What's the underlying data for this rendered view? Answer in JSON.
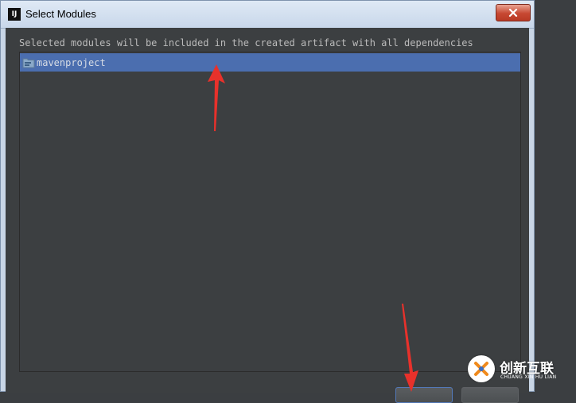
{
  "window": {
    "title": "Select Modules",
    "app_icon": "intellij-icon",
    "close_icon": "close-icon"
  },
  "dialog": {
    "description": "Selected modules will be included in the created artifact with all dependencies",
    "modules": [
      {
        "label": "mavenproject",
        "icon": "module-folder-icon",
        "selected": true
      }
    ]
  },
  "annotations": {
    "arrow_color": "#e8312b"
  },
  "watermark": {
    "brand": "创新互联",
    "sub": "CHUANG XIN HU LIAN"
  },
  "colors": {
    "selection": "#4b6eaf",
    "background": "#3c3f41"
  }
}
